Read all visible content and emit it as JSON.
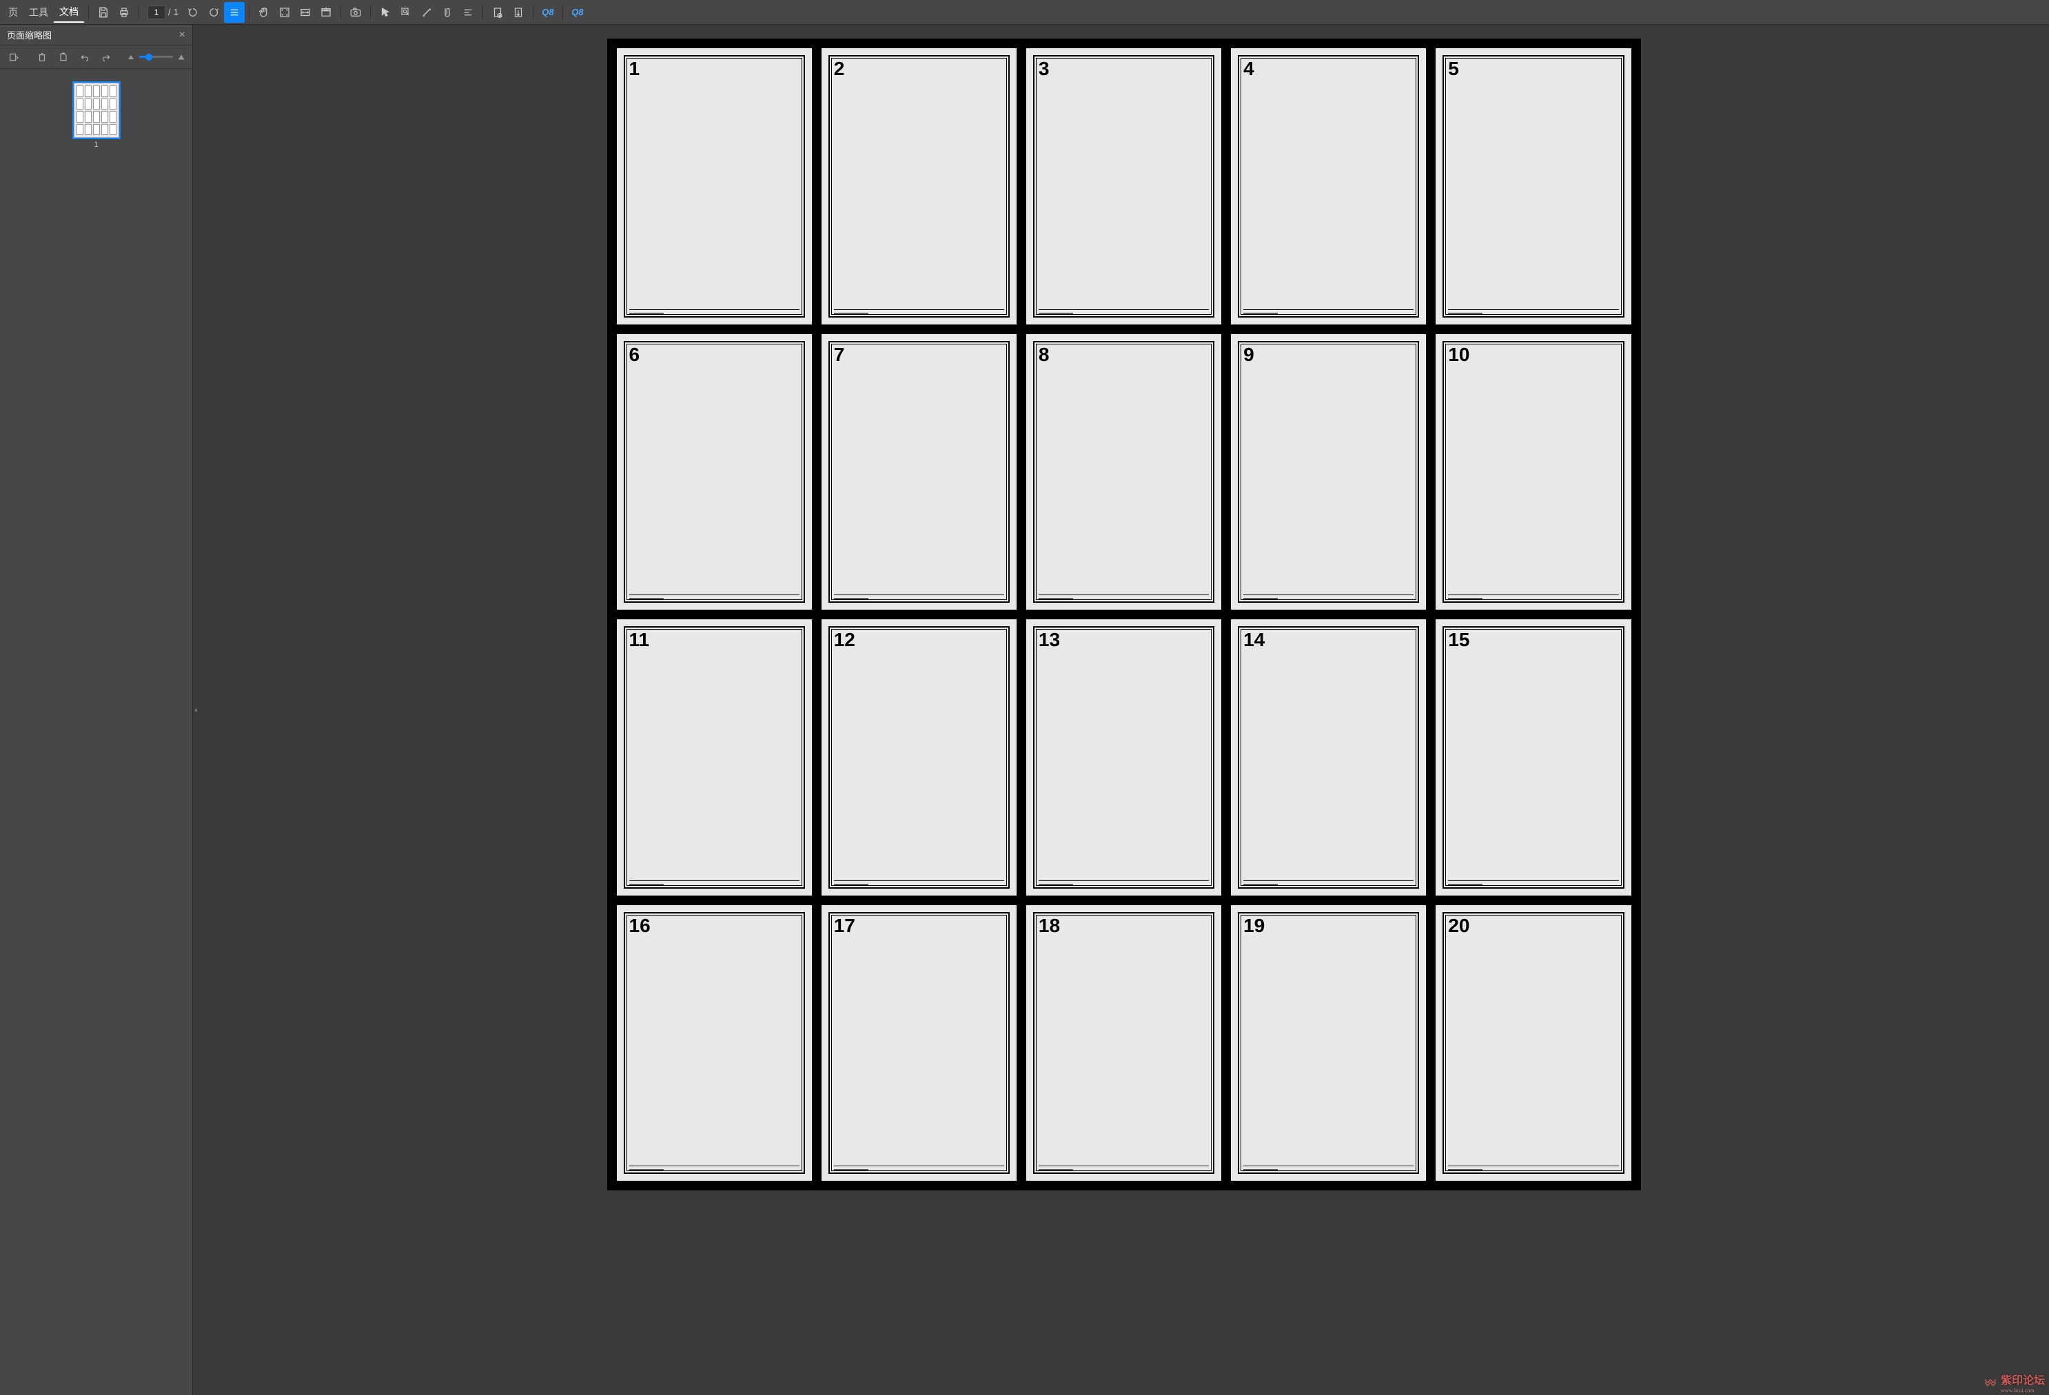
{
  "menu": {
    "items": [
      "页",
      "工具",
      "文档"
    ],
    "active_index": 2
  },
  "toolbar": {
    "page_current": "1",
    "page_sep": "/",
    "page_total": "1",
    "q1": "Q8",
    "q2": "Q8"
  },
  "sidebar": {
    "panel_title": "页面缩略图",
    "thumb_label": "1"
  },
  "document": {
    "grid_cols": 5,
    "grid_rows": 4,
    "cards": [
      {
        "n": "1"
      },
      {
        "n": "2"
      },
      {
        "n": "3"
      },
      {
        "n": "4"
      },
      {
        "n": "5"
      },
      {
        "n": "6"
      },
      {
        "n": "7"
      },
      {
        "n": "8"
      },
      {
        "n": "9"
      },
      {
        "n": "10"
      },
      {
        "n": "11"
      },
      {
        "n": "12"
      },
      {
        "n": "13"
      },
      {
        "n": "14"
      },
      {
        "n": "15"
      },
      {
        "n": "16"
      },
      {
        "n": "17"
      },
      {
        "n": "18"
      },
      {
        "n": "19"
      },
      {
        "n": "20"
      }
    ]
  },
  "watermark": {
    "text": "紫印论坛",
    "sub": "www.licai.com"
  }
}
